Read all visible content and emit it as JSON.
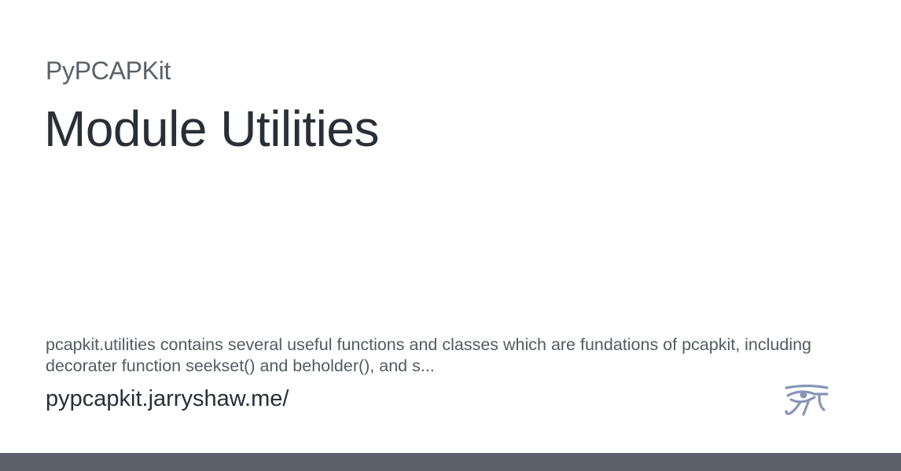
{
  "site": {
    "name": "PyPCAPKit"
  },
  "page": {
    "title": "Module Utilities",
    "description": "pcapkit.utilities contains several useful functions and classes which are fundations of pcapkit, including decorater function seekset() and beholder(), and s...",
    "url": "pypcapkit.jarryshaw.me/"
  },
  "logo": {
    "icon": "eye-of-horus-icon",
    "color": "#8796b6"
  },
  "colors": {
    "bottom_bar": "#5b606b",
    "title": "#2a2e36",
    "site_name": "#5b5f66"
  }
}
